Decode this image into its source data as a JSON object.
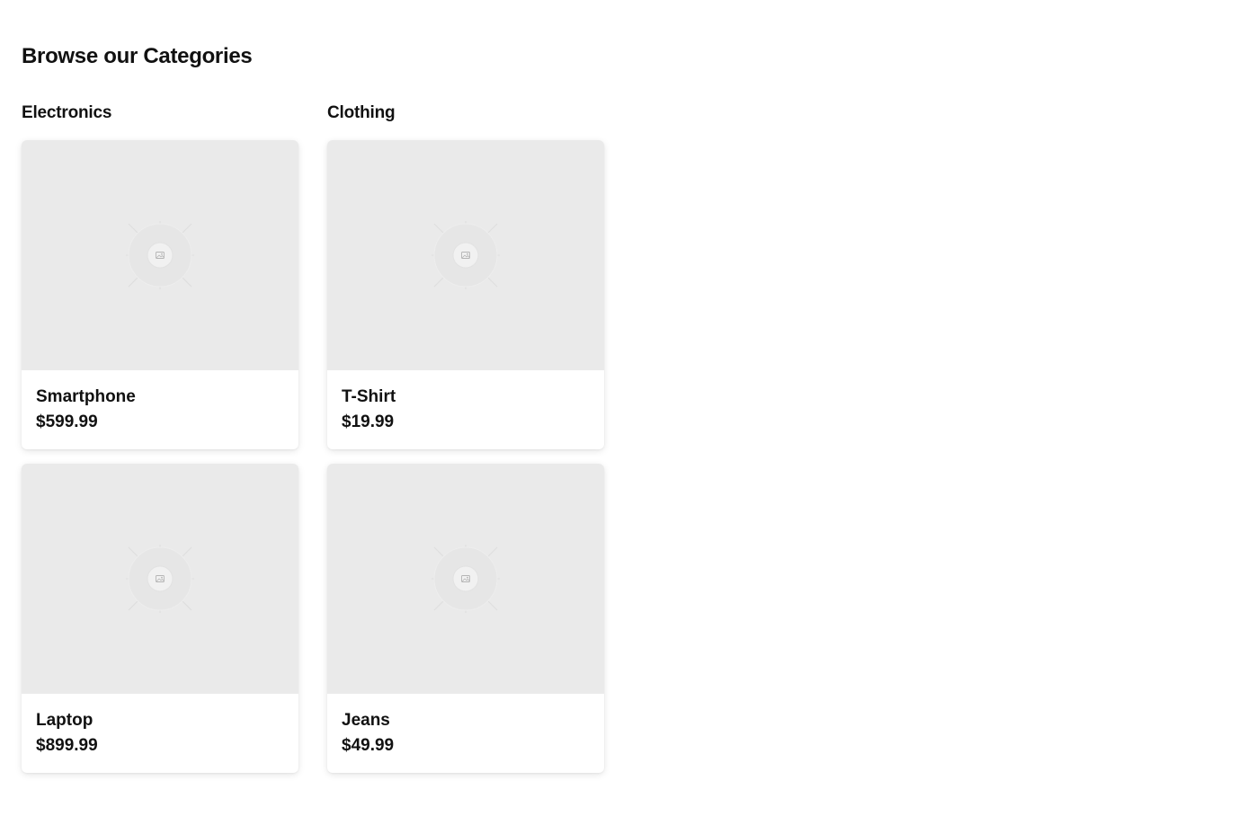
{
  "page": {
    "title": "Browse our Categories"
  },
  "categories": [
    {
      "name": "Electronics",
      "products": [
        {
          "name": "Smartphone",
          "price": "$599.99",
          "image_icon": "image-placeholder-icon"
        },
        {
          "name": "Laptop",
          "price": "$899.99",
          "image_icon": "image-placeholder-icon"
        }
      ]
    },
    {
      "name": "Clothing",
      "products": [
        {
          "name": "T-Shirt",
          "price": "$19.99",
          "image_icon": "image-placeholder-icon"
        },
        {
          "name": "Jeans",
          "price": "$49.99",
          "image_icon": "image-placeholder-icon"
        }
      ]
    }
  ],
  "colors": {
    "image_background": "#eaeaea",
    "text": "#111111",
    "card_background": "#ffffff"
  }
}
